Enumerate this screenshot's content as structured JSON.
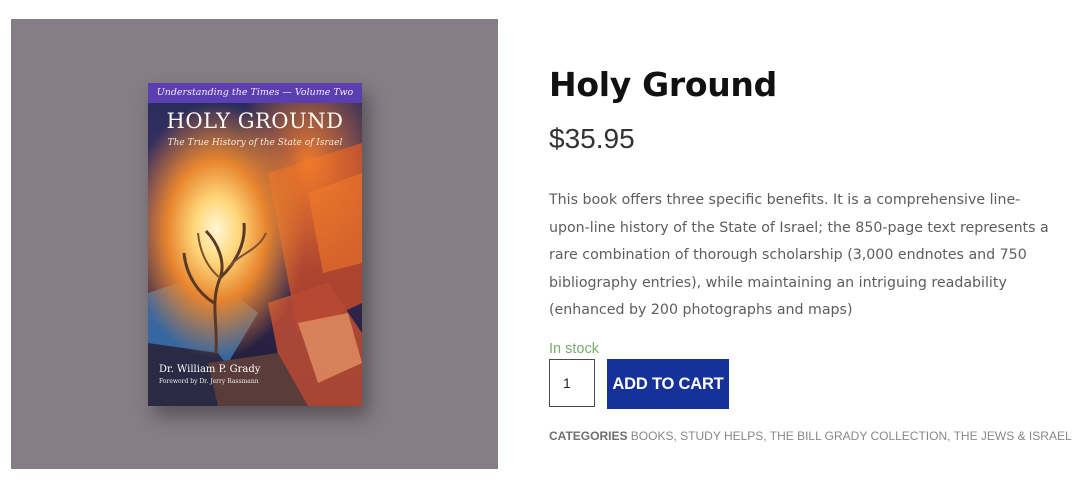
{
  "cover": {
    "series": "Understanding the Times — Volume Two",
    "title": "HOLY GROUND",
    "subtitle": "The True History of the State of Israel",
    "author": "Dr. William P. Grady",
    "foreword": "Foreword by Dr. Jerry Rassmann"
  },
  "product": {
    "title": "Holy Ground",
    "price": "$35.95",
    "description": "This book offers three specific benefits. It is a comprehensive line-upon-line history of the State of Israel; the 850-page text represents a rare combination of thorough scholarship (3,000 endnotes and 750 bibliography entries), while maintaining an intriguing readability (enhanced by 200 photographs and maps)",
    "stock": "In stock",
    "quantity": "1",
    "add_to_cart": "ADD TO CART"
  },
  "categories": {
    "label": "CATEGORIES",
    "items": [
      "BOOKS",
      "STUDY HELPS",
      "THE BILL GRADY COLLECTION",
      "THE JEWS & ISRAEL"
    ]
  },
  "colors": {
    "gallery_bg": "#857e84",
    "button": "#16329a",
    "in_stock": "#7aab6b"
  }
}
